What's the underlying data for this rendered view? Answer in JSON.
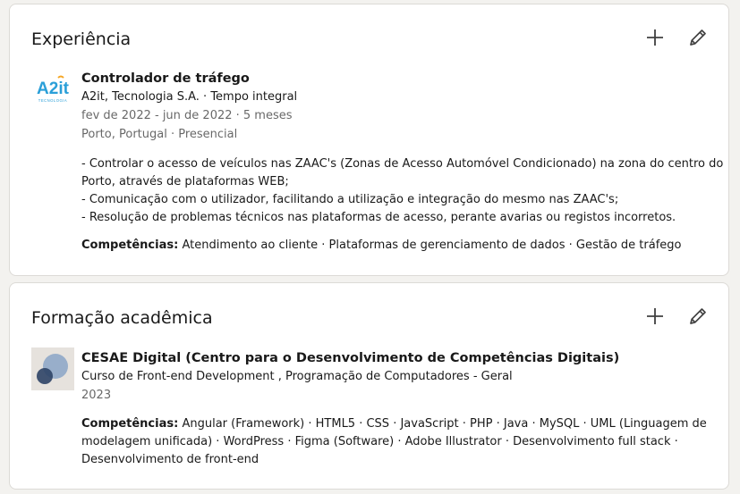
{
  "experience": {
    "section_title": "Experiência",
    "add_icon": "plus-icon",
    "edit_icon": "pencil-icon",
    "logo": "a2it-logo",
    "logo_text": "A2it",
    "logo_subtext": "TECNOLOGIA",
    "position": "Controlador de tráfego",
    "company_line": "A2it, Tecnologia S.A. · Tempo integral",
    "dates": "fev de 2022 - jun de 2022 · 5 meses",
    "location": "Porto, Portugal · Presencial",
    "description": [
      "- Controlar o acesso de veículos nas ZAAC's (Zonas de Acesso Automóvel Condicionado) na zona do centro do",
      "Porto, através de plataformas WEB;",
      "- Comunicação com o utilizador, facilitando a utilização e integração do mesmo nas ZAAC's;",
      "- Resolução de problemas técnicos nas plataformas de acesso, perante avarias ou registos incorretos."
    ],
    "skills_label": "Competências:",
    "skills_text": "Atendimento ao cliente · Plataformas de gerenciamento de dados · Gestão de tráfego"
  },
  "education": {
    "section_title": "Formação acadêmica",
    "add_icon": "plus-icon",
    "edit_icon": "pencil-icon",
    "logo": "school-logo",
    "school": "CESAE Digital (Centro para o Desenvolvimento de Competências Digitais)",
    "degree": "Curso de Front-end Development , Programação de Computadores - Geral",
    "year": "2023",
    "skills_label": "Competências:",
    "skills_text": "Angular (Framework) · HTML5 · CSS · JavaScript · PHP · Java · MySQL · UML (Linguagem de modelagem unificada) · WordPress · Figma (Software) · Adobe Illustrator · Desenvolvimento full stack · Desenvolvimento de front-end"
  },
  "colors": {
    "page_bg": "#f3f2ef",
    "card_bg": "#ffffff",
    "a2it_blue": "#2a9fd8",
    "school_circle_light": "#8fa9c8",
    "school_circle_dark": "#2e4466"
  }
}
